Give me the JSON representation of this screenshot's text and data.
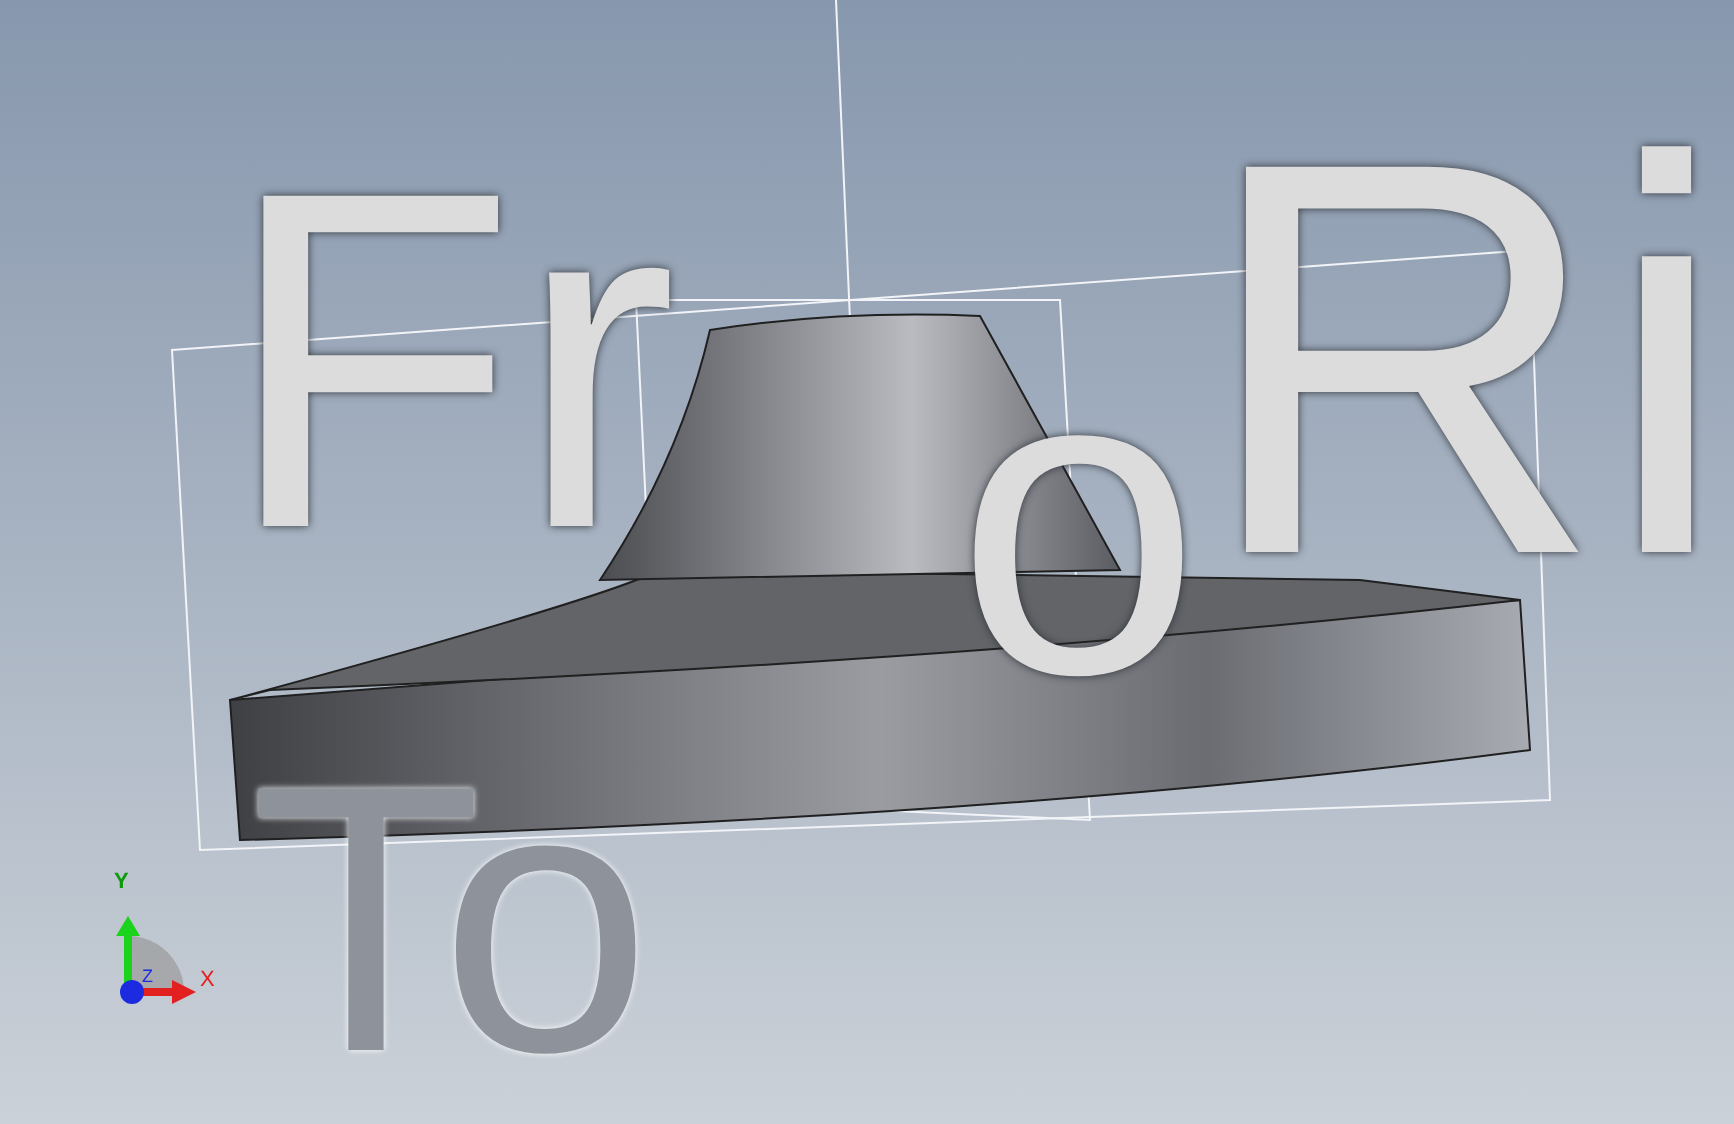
{
  "view_labels": [
    {
      "text": "Fr"
    },
    {
      "text": "o"
    },
    {
      "text": "Ri"
    },
    {
      "text": "To"
    }
  ],
  "triad": {
    "x_label": "X",
    "y_label": "Y",
    "z_label": "Z"
  }
}
